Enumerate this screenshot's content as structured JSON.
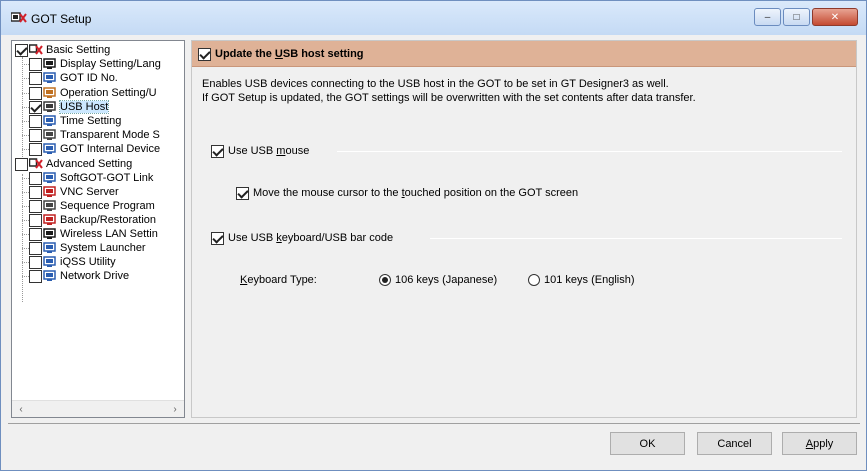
{
  "window": {
    "title": "GOT Setup",
    "controls": {
      "minimize": "–",
      "maximize": "□",
      "close": "✕"
    }
  },
  "tree": {
    "items": [
      {
        "label": "Basic Setting",
        "checked": true,
        "icon": "basic-setting-icon",
        "level": 0
      },
      {
        "label": "Display Setting/Lang",
        "checked": false,
        "icon": "display-setting-icon",
        "level": 1
      },
      {
        "label": "GOT ID No.",
        "checked": false,
        "icon": "got-id-icon",
        "level": 1
      },
      {
        "label": "Operation Setting/U",
        "checked": false,
        "icon": "operation-setting-icon",
        "level": 1
      },
      {
        "label": "USB Host",
        "checked": true,
        "icon": "usb-icon",
        "level": 1,
        "selected": true
      },
      {
        "label": "Time Setting",
        "checked": false,
        "icon": "clock-icon",
        "level": 1
      },
      {
        "label": "Transparent Mode S",
        "checked": false,
        "icon": "transparent-mode-icon",
        "level": 1
      },
      {
        "label": "GOT Internal Device",
        "checked": false,
        "icon": "internal-device-icon",
        "level": 1
      },
      {
        "label": "Advanced Setting",
        "checked": false,
        "icon": "advanced-setting-icon",
        "level": 0
      },
      {
        "label": "SoftGOT-GOT Link",
        "checked": false,
        "icon": "softgot-link-icon",
        "level": 1
      },
      {
        "label": "VNC Server",
        "checked": false,
        "icon": "vnc-server-icon",
        "level": 1
      },
      {
        "label": "Sequence Program",
        "checked": false,
        "icon": "sequence-program-icon",
        "level": 1
      },
      {
        "label": "Backup/Restoration",
        "checked": false,
        "icon": "backup-icon",
        "level": 1
      },
      {
        "label": "Wireless LAN Settin",
        "checked": false,
        "icon": "wireless-lan-icon",
        "level": 1
      },
      {
        "label": "System Launcher",
        "checked": false,
        "icon": "system-launcher-icon",
        "level": 1
      },
      {
        "label": "iQSS Utility",
        "checked": false,
        "icon": "iqss-utility-icon",
        "level": 1
      },
      {
        "label": "Network Drive",
        "checked": false,
        "icon": "network-drive-icon",
        "level": 1
      }
    ],
    "scroll_left": "‹",
    "scroll_right": "›"
  },
  "panel": {
    "header_label": "Update the USB host setting",
    "header_checked": true,
    "description_line1": "Enables USB devices connecting to the USB host in the GOT to be set in GT Designer3 as well.",
    "description_line2": "If GOT Setup is updated, the GOT settings will be overwritten with the set contents after data transfer.",
    "use_usb_mouse": {
      "label_pre": "Use USB ",
      "label_u": "m",
      "label_post": "ouse",
      "checked": true
    },
    "move_cursor": {
      "label_pre": "Move the mouse cursor to the ",
      "label_u": "t",
      "label_post": "ouched position on the GOT screen",
      "checked": true
    },
    "use_keyboard": {
      "label_pre": "Use USB ",
      "label_u": "k",
      "label_post": "eyboard/USB bar code",
      "checked": true
    },
    "keyboard_type": {
      "label_u": "K",
      "label_post": "eyboard Type:",
      "options": [
        {
          "label": "106 keys (Japanese)",
          "selected": true
        },
        {
          "label": "101 keys (English)",
          "selected": false
        }
      ]
    }
  },
  "buttons": {
    "ok": "OK",
    "cancel": "Cancel",
    "apply_u": "A",
    "apply_post": "pply"
  }
}
